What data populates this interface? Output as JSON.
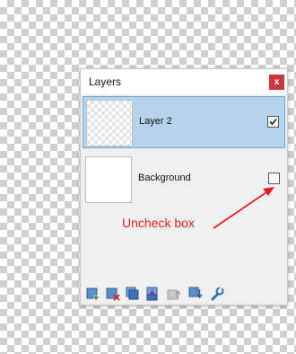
{
  "panel": {
    "title": "Layers",
    "close_label": "x"
  },
  "layers": [
    {
      "name": "Layer 2",
      "visible": true,
      "selected": true,
      "thumbnail": "transparent"
    },
    {
      "name": "Background",
      "visible": false,
      "selected": false,
      "thumbnail": "white"
    }
  ],
  "annotation": {
    "text": "Uncheck box",
    "color": "#e02020"
  },
  "toolbar": {
    "icons": [
      "add-layer-icon",
      "delete-layer-icon",
      "duplicate-layer-icon",
      "merge-down-icon",
      "move-up-icon",
      "move-down-icon",
      "properties-icon"
    ]
  },
  "colors": {
    "selected_row": "#b5d3ec",
    "close_button": "#c9373f",
    "annotation": "#e02020"
  }
}
